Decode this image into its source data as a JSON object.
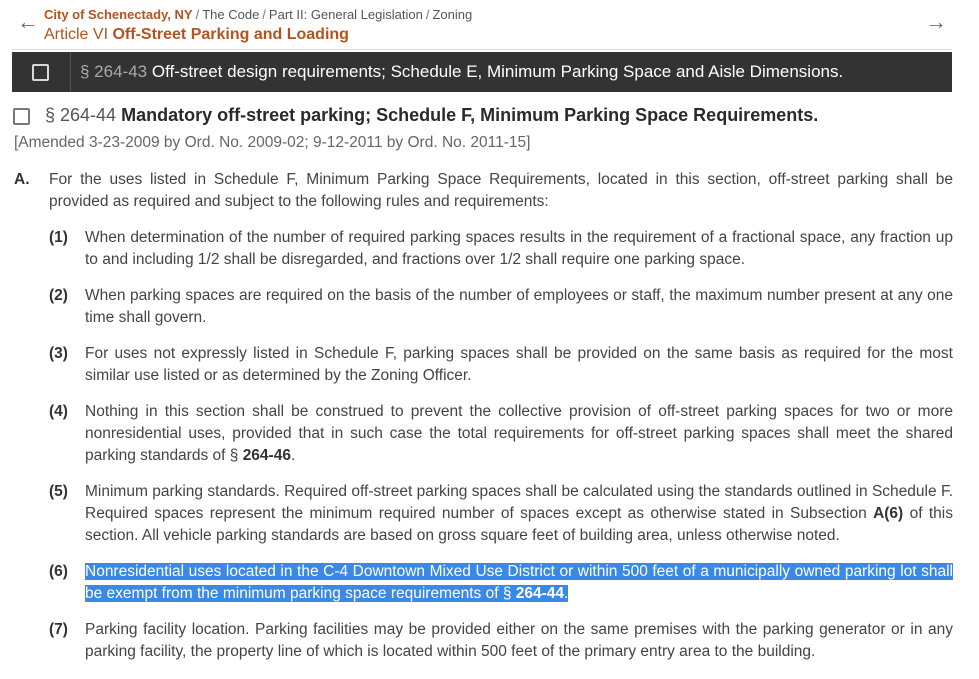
{
  "nav": {
    "back_icon": "arrow-left-icon",
    "forward_icon": "arrow-right-icon",
    "breadcrumbs": {
      "municipality": "City of Schenectady, NY",
      "code": "The Code",
      "part": "Part II: General Legislation",
      "chapter": "Zoning"
    },
    "article_prefix": "Article VI",
    "article_title": "Off-Street Parking and Loading"
  },
  "prev_section": {
    "number": "§ 264-43",
    "title": "Off-street design requirements; Schedule E, Minimum Parking Space and Aisle Dimensions."
  },
  "section": {
    "number": "§ 264-44",
    "title": "Mandatory off-street parking; Schedule F, Minimum Parking Space Requirements.",
    "amended": "[Amended 3-23-2009 by Ord. No. 2009-02; 9-12-2011 by Ord. No. 2011-15]"
  },
  "subsection_a": {
    "label": "A.",
    "text": "For the uses listed in Schedule F, Minimum Parking Space Requirements, located in this section, off-street parking shall be provided as required and subject to the following rules and requirements:"
  },
  "items": [
    {
      "label": "(1)",
      "text": "When determination of the number of required parking spaces results in the requirement of a fractional space, any fraction up to and including 1/2 shall be disregarded, and fractions over 1/2 shall require one parking space."
    },
    {
      "label": "(2)",
      "text": "When parking spaces are required on the basis of the number of employees or staff, the maximum number present at any one time shall govern."
    },
    {
      "label": "(3)",
      "text": "For uses not expressly listed in Schedule F, parking spaces shall be provided on the same basis as required for the most similar use listed or as determined by the Zoning Officer."
    },
    {
      "label": "(4)",
      "text": "Nothing in this section shall be construed to prevent the collective provision of off-street parking spaces for two or more nonresidential uses, provided that in such case the total requirements for off-street parking spaces shall meet the shared parking standards of § ",
      "ref": "264-46",
      "tail": "."
    },
    {
      "label": "(5)",
      "text": "Minimum parking standards. Required off-street parking spaces shall be calculated using the standards outlined in Schedule F. Required spaces represent the minimum required number of spaces except as otherwise stated in Subsection ",
      "ref": "A(6)",
      "tail": " of this section. All vehicle parking standards are based on gross square feet of building area, unless otherwise noted."
    },
    {
      "label": "(6)",
      "text": "Nonresidential uses located in the C-4 Downtown Mixed Use District or within 500 feet of a municipally owned parking lot shall be exempt from the minimum parking space requirements of § ",
      "ref": "264-44",
      "tail": "."
    },
    {
      "label": "(7)",
      "text": "Parking facility location. Parking facilities may be provided either on the same premises with the parking generator or in any parking facility, the property line of which is located within 500 feet of the primary entry area to the building."
    }
  ],
  "highlight_color": "#3b89e6",
  "accent_color": "#b5531c"
}
